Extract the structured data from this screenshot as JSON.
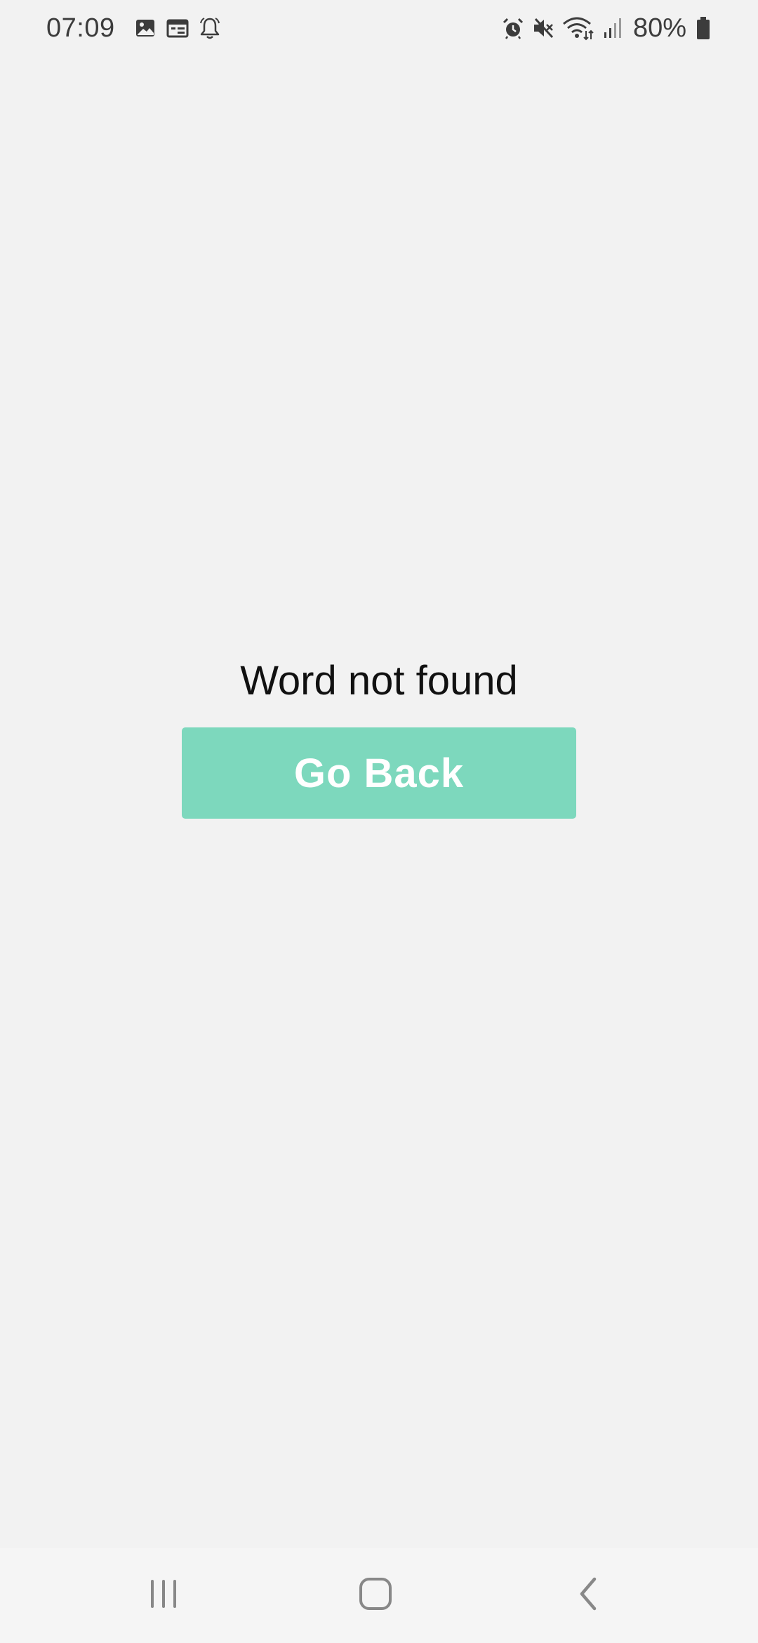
{
  "status_bar": {
    "time": "07:09",
    "left_icons": [
      "gallery-icon",
      "calendar-icon",
      "bell-icon"
    ],
    "right_icons": [
      "alarm-icon",
      "mute-icon",
      "wifi-icon",
      "signal-icon"
    ],
    "battery_percent": "80%"
  },
  "main": {
    "message": "Word not found",
    "button_label": "Go Back"
  },
  "colors": {
    "background": "#f2f2f2",
    "button": "#7dd8bd",
    "button_text": "#ffffff"
  },
  "nav_bar": {
    "icons": [
      "recents-icon",
      "home-icon",
      "back-icon"
    ]
  }
}
